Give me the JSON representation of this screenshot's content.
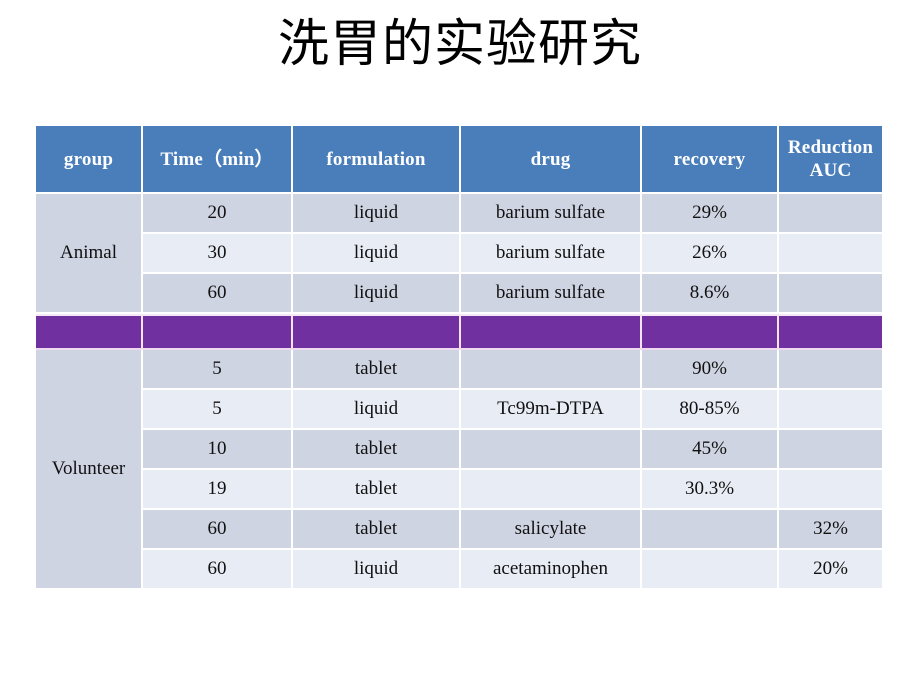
{
  "slide": {
    "title": "洗胃的实验研究",
    "colors": {
      "header_blue": "#4A7EBB",
      "separator_purple": "#7030A0",
      "band_dark": "#CFD4E2",
      "band_light": "#E8ECF4",
      "group_cell": "#CDD3E1",
      "text": "#111111"
    }
  },
  "table": {
    "columns": [
      {
        "key": "group",
        "label": "group"
      },
      {
        "key": "time",
        "label": "Time（min）"
      },
      {
        "key": "formulation",
        "label": "formulation"
      },
      {
        "key": "drug",
        "label": "drug"
      },
      {
        "key": "recovery",
        "label": "recovery"
      },
      {
        "key": "reduction_auc",
        "label": "Reduction AUC"
      }
    ],
    "groups": [
      {
        "name": "Animal",
        "rows": [
          {
            "time": "20",
            "formulation": "liquid",
            "drug": "barium sulfate",
            "recovery": "29%",
            "reduction_auc": ""
          },
          {
            "time": "30",
            "formulation": "liquid",
            "drug": "barium sulfate",
            "recovery": "26%",
            "reduction_auc": ""
          },
          {
            "time": "60",
            "formulation": "liquid",
            "drug": "barium sulfate",
            "recovery": "8.6%",
            "reduction_auc": ""
          }
        ]
      },
      {
        "name": "Volunteer",
        "rows": [
          {
            "time": "5",
            "formulation": "tablet",
            "drug": "",
            "recovery": "90%",
            "reduction_auc": ""
          },
          {
            "time": "5",
            "formulation": "liquid",
            "drug": "Tc99m-DTPA",
            "recovery": "80-85%",
            "reduction_auc": ""
          },
          {
            "time": "10",
            "formulation": "tablet",
            "drug": "",
            "recovery": "45%",
            "reduction_auc": ""
          },
          {
            "time": "19",
            "formulation": "tablet",
            "drug": "",
            "recovery": "30.3%",
            "reduction_auc": ""
          },
          {
            "time": "60",
            "formulation": "tablet",
            "drug": "salicylate",
            "recovery": "",
            "reduction_auc": "32%"
          },
          {
            "time": "60",
            "formulation": "liquid",
            "drug": "acetaminophen",
            "recovery": "",
            "reduction_auc": "20%"
          }
        ]
      }
    ],
    "separator_row": {
      "cells": [
        "",
        "",
        "",
        "",
        "",
        ""
      ]
    }
  }
}
